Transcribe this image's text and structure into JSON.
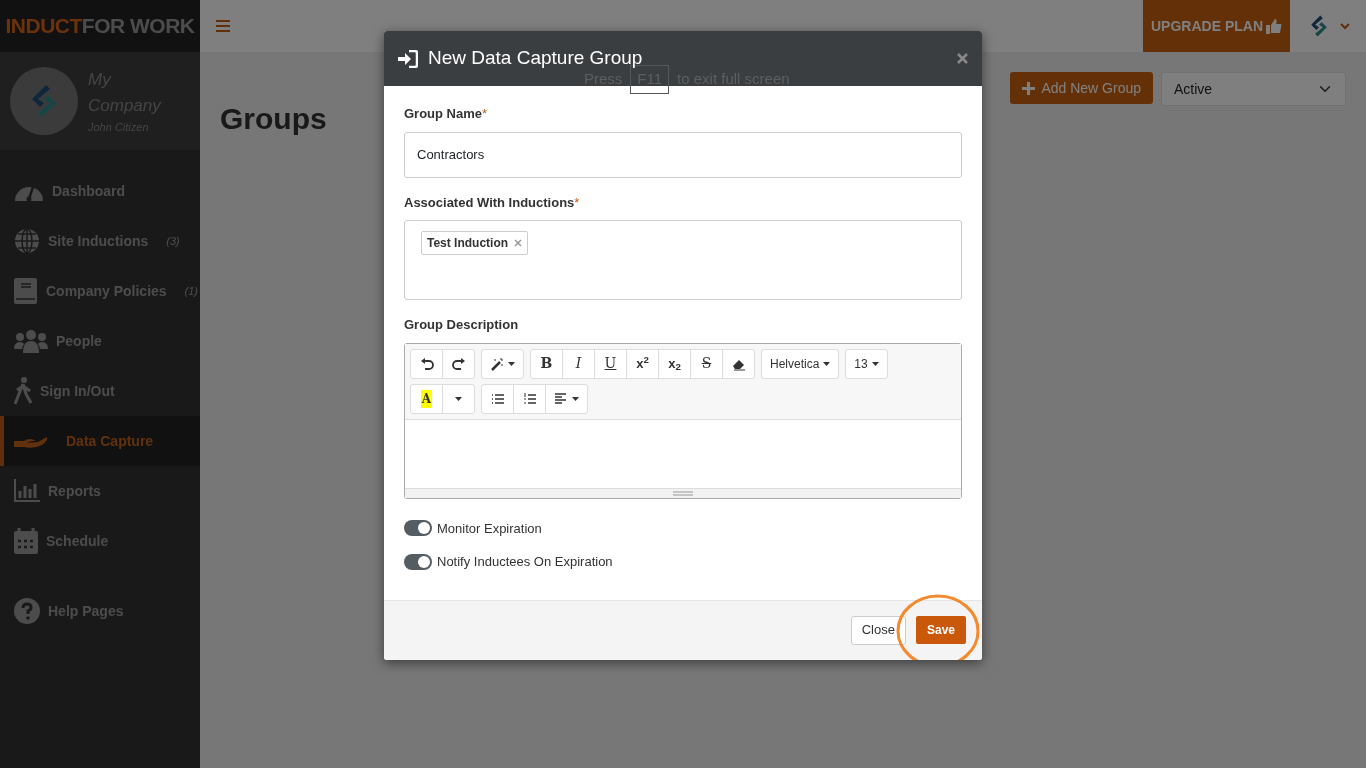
{
  "logo": {
    "accent": "INDUCT",
    "rest": "FOR WORK"
  },
  "profile": {
    "company": "My Company",
    "user": "John Citizen"
  },
  "sidebar": {
    "items": [
      {
        "label": "Dashboard",
        "selected": false
      },
      {
        "label": "Site Inductions",
        "count": "(3)",
        "selected": false
      },
      {
        "label": "Company Policies",
        "count": "(1)",
        "selected": false
      },
      {
        "label": "People",
        "selected": false
      },
      {
        "label": "Sign In/Out",
        "selected": false
      },
      {
        "label": "Data Capture",
        "selected": true
      },
      {
        "label": "Reports",
        "selected": false
      },
      {
        "label": "Schedule",
        "selected": false
      },
      {
        "label": "Help Pages",
        "selected": false
      }
    ]
  },
  "topbar": {
    "upgrade": "UPGRADE PLAN"
  },
  "page": {
    "title": "Groups",
    "add_button": "Add New Group",
    "filter": "Active"
  },
  "fullscreen_notice": {
    "before": "Press",
    "key": "F11",
    "after": "to exit full screen"
  },
  "modal": {
    "title": "New Data Capture Group",
    "name_label": "Group Name",
    "name_value": "Contractors",
    "inductions_label": "Associated With Inductions",
    "inductions": [
      "Test Induction"
    ],
    "required_mark": "*",
    "description_label": "Group Description",
    "toolbar": {
      "bold": "B",
      "italic": "I",
      "underline": "U",
      "superscript": "x$^{2}$",
      "subscript": "x$_{2}$",
      "strikethrough": "S",
      "highlight": "A",
      "font": "Helvetica",
      "size": "13"
    },
    "toggles": [
      {
        "label": "Monitor Expiration",
        "on": true
      },
      {
        "label": "Notify Inductees On Expiration",
        "on": true
      }
    ],
    "close_button": "Close",
    "save_button": "Save"
  }
}
